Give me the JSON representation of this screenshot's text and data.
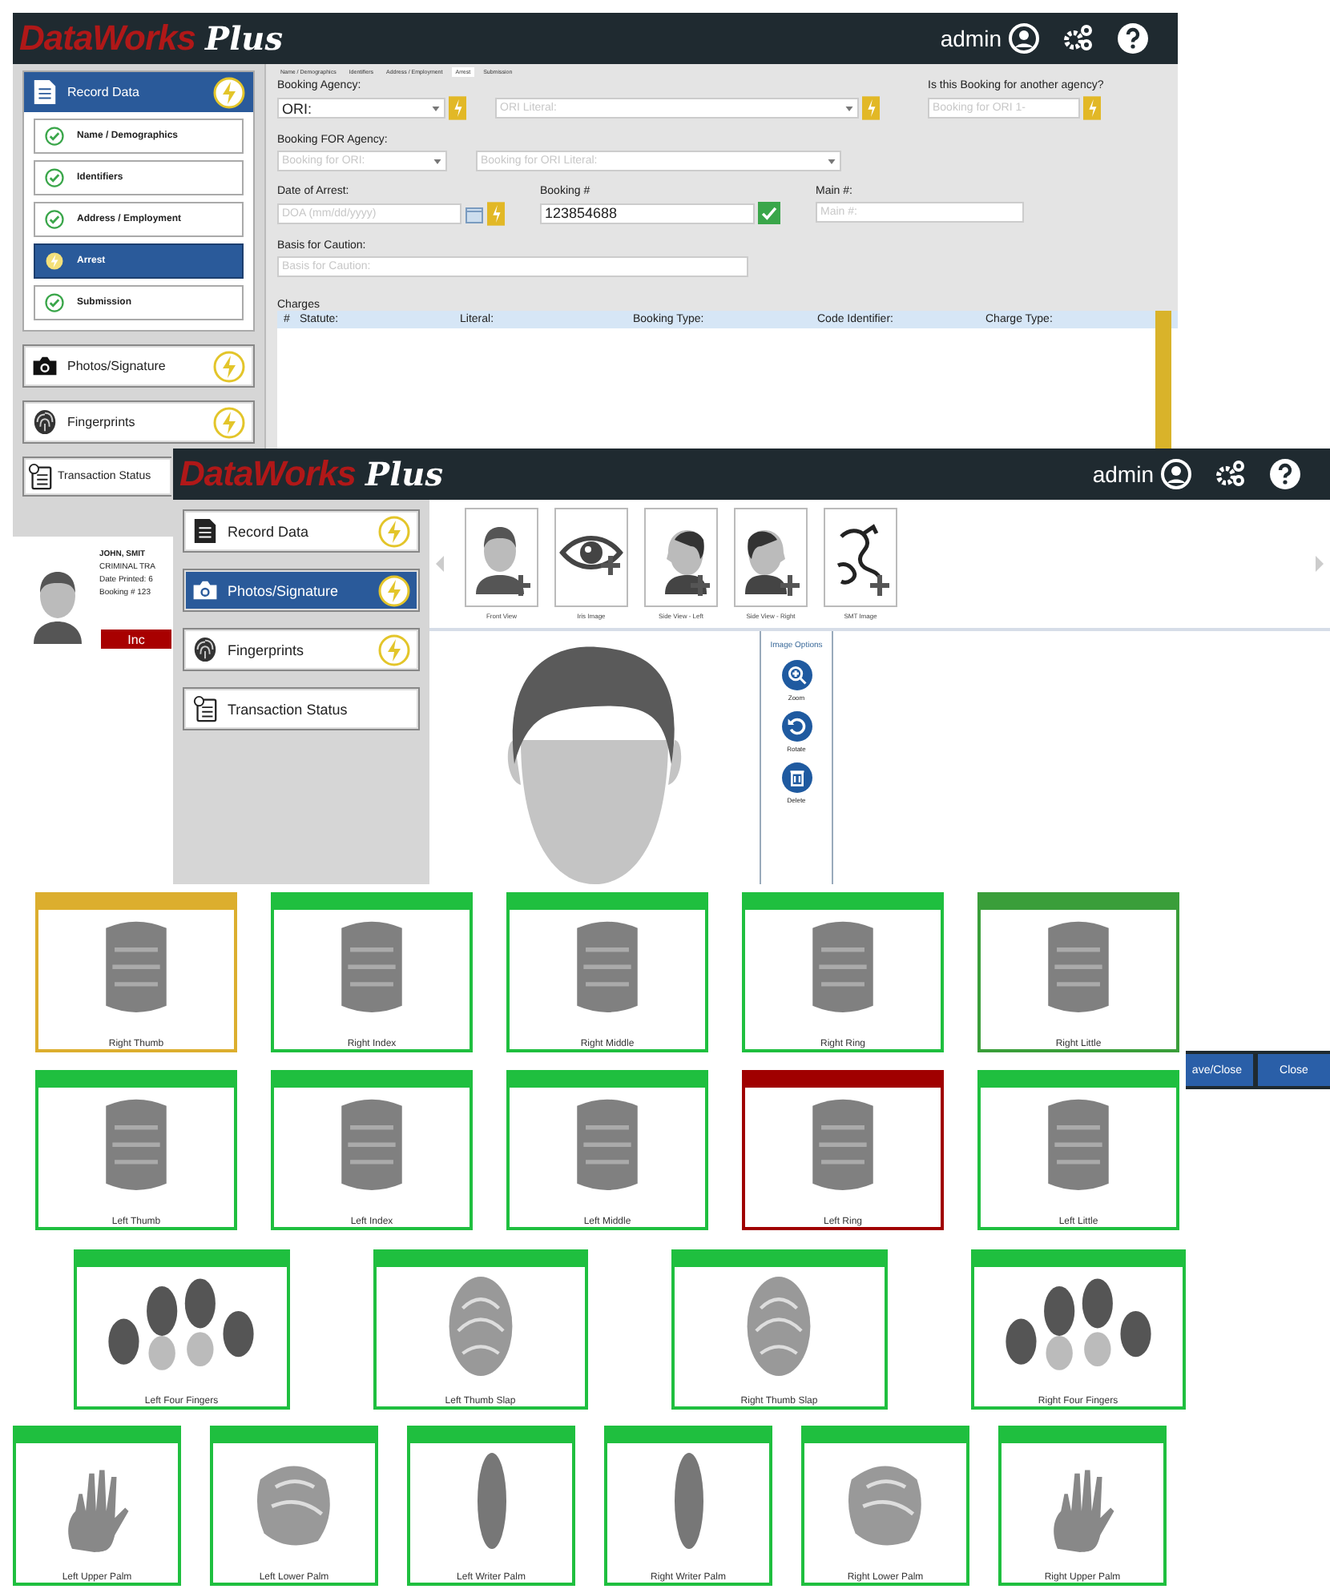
{
  "window_back": {
    "logo": {
      "brand": "DataWorks",
      "suffix": "Plus"
    },
    "user": "admin",
    "sidebar": [
      {
        "label": "Record Data",
        "kind": "document",
        "selected": true,
        "pending": true,
        "children": [
          {
            "label": "Name / Demographics",
            "complete": true,
            "selected": false
          },
          {
            "label": "Identifiers",
            "complete": true,
            "selected": false
          },
          {
            "label": "Address / Employment",
            "complete": true,
            "selected": false
          },
          {
            "label": "Arrest",
            "complete": false,
            "selected": true
          },
          {
            "label": "Submission",
            "complete": true,
            "selected": false
          }
        ]
      },
      {
        "label": "Photos/Signature",
        "kind": "camera",
        "selected": false,
        "pending": true
      },
      {
        "label": "Fingerprints",
        "kind": "fingerprint",
        "selected": false,
        "pending": true
      },
      {
        "label": "Transaction Status",
        "kind": "checklist",
        "selected": false,
        "pending": false
      }
    ],
    "step_tabs": [
      {
        "label": "Name / Demographics",
        "selected": false
      },
      {
        "label": "Identifiers",
        "selected": false
      },
      {
        "label": "Address / Employment",
        "selected": false
      },
      {
        "label": "Arrest",
        "selected": true
      },
      {
        "label": "Submission",
        "selected": false
      }
    ],
    "form_rows": [
      [
        {
          "label": "Booking Agency:",
          "value": "ORI:",
          "dropdown": true,
          "bolt": true
        },
        {
          "placeholder": "ORI Literal:",
          "dropdown": true,
          "bolt": true
        },
        {
          "label": "Is this Booking for another agency?",
          "placeholder": "Booking for ORI 1-",
          "bolt": true
        }
      ],
      [
        {
          "label": "Booking FOR Agency:",
          "placeholder": "Booking for ORI:",
          "dropdown": true
        },
        {
          "placeholder": "Booking for ORI Literal:",
          "dropdown": true
        }
      ],
      [
        {
          "label": "Date of Arrest:",
          "placeholder": "DOA (mm/dd/yyyy)",
          "calendar": true,
          "bolt": true
        },
        {
          "label": "Booking #",
          "value": "123854688",
          "verified": true
        },
        {
          "label": "Main #:",
          "placeholder": "Main #:"
        }
      ],
      [
        {
          "label": "Basis for Caution:",
          "placeholder": "Basis for Caution:"
        }
      ]
    ],
    "charges": {
      "title": "Charges",
      "columns": [
        "#",
        "Statute:",
        "Literal:",
        "Booking Type:",
        "Code Identifier:",
        "Charge Type:"
      ]
    },
    "person": {
      "name": "JOHN, SMIT",
      "lines": [
        "CRIMINAL TRA",
        "Date Printed: 6",
        "Booking # 123"
      ],
      "status": "Inc"
    }
  },
  "window_front": {
    "logo": {
      "brand": "DataWorks",
      "suffix": "Plus"
    },
    "user": "admin",
    "sidebar": [
      {
        "label": "Record Data",
        "kind": "document",
        "selected": false,
        "pending": true
      },
      {
        "label": "Photos/Signature",
        "kind": "camera",
        "selected": true,
        "pending": true
      },
      {
        "label": "Fingerprints",
        "kind": "fingerprint",
        "selected": false,
        "pending": true
      },
      {
        "label": "Transaction Status",
        "kind": "checklist",
        "selected": false,
        "pending": false
      }
    ],
    "captures": [
      {
        "label": "Front View",
        "kind": "front"
      },
      {
        "label": "Iris Image",
        "kind": "iris"
      },
      {
        "label": "Side View - Left",
        "kind": "left"
      },
      {
        "label": "Side View - Right",
        "kind": "right"
      },
      {
        "label": "SMT Image",
        "kind": "smt"
      }
    ],
    "image_options": {
      "title": "Image Options",
      "actions": [
        {
          "label": "Zoom",
          "kind": "zoom"
        },
        {
          "label": "Rotate",
          "kind": "rotate"
        },
        {
          "label": "Delete",
          "kind": "delete"
        }
      ]
    },
    "buttons": [
      "ave/Close",
      "Close"
    ]
  },
  "fingerprints": [
    [
      {
        "label": "Right Thumb",
        "kind": "finger",
        "color": "#dcae2e"
      },
      {
        "label": "Right Index",
        "kind": "finger",
        "color": "#1fbf3f"
      },
      {
        "label": "Right Middle",
        "kind": "finger",
        "color": "#1fbf3f"
      },
      {
        "label": "Right Ring",
        "kind": "finger",
        "color": "#1fbf3f"
      },
      {
        "label": "Right Little",
        "kind": "finger",
        "color": "#3a9e3a"
      }
    ],
    [
      {
        "label": "Left Thumb",
        "kind": "finger",
        "color": "#1fbf3f"
      },
      {
        "label": "Left Index",
        "kind": "finger",
        "color": "#1fbf3f"
      },
      {
        "label": "Left Middle",
        "kind": "finger",
        "color": "#1fbf3f"
      },
      {
        "label": "Left Ring",
        "kind": "finger",
        "color": "#a00000"
      },
      {
        "label": "Left Little",
        "kind": "finger",
        "color": "#1fbf3f"
      }
    ],
    [
      {
        "label": "Left Four Fingers",
        "kind": "four",
        "color": "#1fbf3f"
      },
      {
        "label": "Left Thumb Slap",
        "kind": "slap",
        "color": "#1fbf3f"
      },
      {
        "label": "Right Thumb Slap",
        "kind": "slap",
        "color": "#1fbf3f"
      },
      {
        "label": "Right Four Fingers",
        "kind": "four",
        "color": "#1fbf3f"
      }
    ],
    [
      {
        "label": "Left Upper Palm",
        "kind": "hand",
        "color": "#1fbf3f"
      },
      {
        "label": "Left Lower Palm",
        "kind": "palm",
        "color": "#1fbf3f"
      },
      {
        "label": "Left Writer Palm",
        "kind": "writer",
        "color": "#1fbf3f"
      },
      {
        "label": "Right Writer Palm",
        "kind": "writer",
        "color": "#1fbf3f"
      },
      {
        "label": "Right Lower Palm",
        "kind": "palm",
        "color": "#1fbf3f"
      },
      {
        "label": "Right Upper Palm",
        "kind": "hand",
        "color": "#1fbf3f"
      }
    ]
  ]
}
